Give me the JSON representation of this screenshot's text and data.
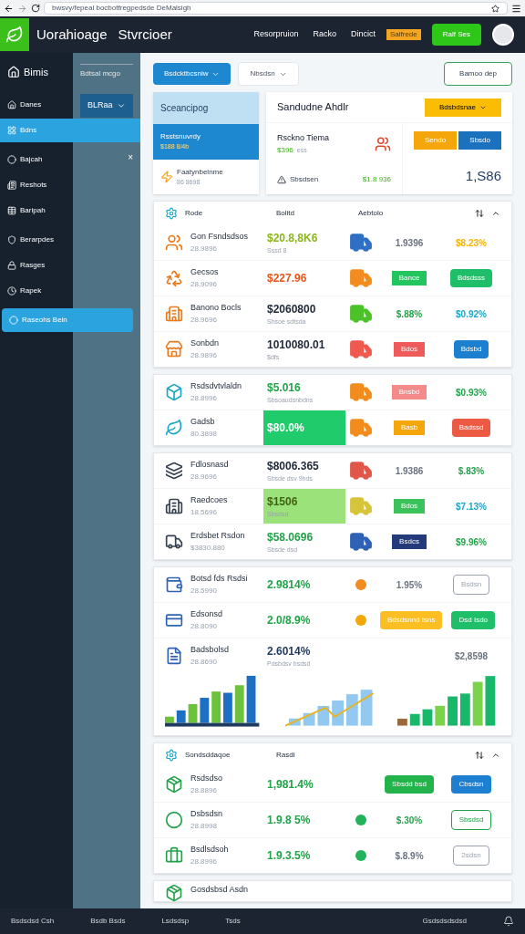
{
  "browser": {
    "url": "bwsvy/fepeal bocbotfregpedsde DeMalsigh"
  },
  "header": {
    "logo_text": "Uorahioage",
    "title": "Stvrcioer",
    "nav": [
      "Resorpruion",
      "Racko",
      "Dincict"
    ],
    "notice": "Salfrede",
    "action": "Ralf Ses"
  },
  "sidebar": {
    "title": "Bimis",
    "items": [
      {
        "label": "Danes",
        "selected": false
      },
      {
        "label": "Bdns",
        "selected": true
      },
      {
        "label": "Bajcah",
        "selected": false
      },
      {
        "label": "Reshots",
        "selected": false
      },
      {
        "label": "Baripah",
        "selected": false
      },
      {
        "label": "Berarpdes",
        "selected": false
      },
      {
        "label": "Rasges",
        "selected": false
      },
      {
        "label": "Rapek",
        "selected": false
      },
      {
        "label": "Raseohs Bein",
        "selected": true
      }
    ]
  },
  "subpanel": {
    "heading": "Bdtsal mcgo",
    "dropdown": "BLRaa",
    "close": "×"
  },
  "toolbar": {
    "primary": "Bsdcktbcsniw",
    "filter": "Nbsdsn",
    "export": "Bamoo dep"
  },
  "summary_left": {
    "title": "Sceancipog",
    "items": [
      {
        "name": "Rsstsnuvrdy",
        "sub": "$188 8/4b",
        "selected": true
      },
      {
        "name": "Faatynbelnme",
        "sub": "86 8698",
        "selected": false
      }
    ]
  },
  "summary_right": {
    "title": "Sandudne Ahdlr",
    "action": "Bdsbdsnae",
    "name": "Rsckno Tiema",
    "name_value": "$396",
    "name_note": "ess",
    "stat_label": "Sbsdsen",
    "stat_value": "$1.8 936",
    "buttons": [
      "Sendo",
      "Sbsdo"
    ],
    "total": "1,S86"
  },
  "sections": [
    {
      "columns": [
        "Rode",
        "Bolitd",
        "Aebtolo"
      ],
      "rows": [
        {
          "name": "Gon Fsndsdsos",
          "sub": "28.9896",
          "value": {
            "text": "$20.8,8K6",
            "color": "#8cb61c",
            "note": "Sssd 8"
          },
          "cells": [
            {
              "kind": "truck",
              "color": "#2f6fc4"
            },
            {
              "kind": "text",
              "text": "1.9396",
              "color": "#6b7280"
            },
            {
              "kind": "text",
              "text": "$8.23%",
              "color": "#f4b400"
            }
          ]
        },
        {
          "name": "Gecsos",
          "sub": "28.9096",
          "value": {
            "text": "$227.96",
            "color": "#e2571c"
          },
          "cells": [
            {
              "kind": "truck",
              "color": "#f28c1e"
            },
            {
              "kind": "badge",
              "text": "Bance",
              "color": "#22c55e"
            },
            {
              "kind": "button",
              "text": "Bdsdsss",
              "color": "#1fbf6a"
            }
          ]
        },
        {
          "name": "Banono Bocls",
          "sub": "28.9696",
          "value": {
            "text": "$2060800",
            "color": "#1f2937",
            "note": "Shsoe sdtsda"
          },
          "cells": [
            {
              "kind": "truck",
              "color": "#4cc22a"
            },
            {
              "kind": "text",
              "text": "$.88%",
              "color": "#22a34a"
            },
            {
              "kind": "text",
              "text": "$0.92%",
              "color": "#1aa6c8"
            }
          ]
        },
        {
          "name": "Sonbdn",
          "sub": "28.9896",
          "value": {
            "text": "1010080.01",
            "color": "#1f2937",
            "note": "$dfs"
          },
          "cells": [
            {
              "kind": "truck",
              "color": "#ef5a4f"
            },
            {
              "kind": "badge",
              "text": "Bdos",
              "color": "#ef5a5a"
            },
            {
              "kind": "button",
              "text": "Bdsbd",
              "color": "#1d7fd0"
            }
          ]
        }
      ]
    },
    {
      "rows": [
        {
          "name": "Rsdsdvtvlaldn",
          "sub": "28.8996",
          "value": {
            "text": "$5.016",
            "color": "#22a34a",
            "note": "Sbsoaudsnbdns"
          },
          "cells": [
            {
              "kind": "truck",
              "color": "#f28c1e"
            },
            {
              "kind": "badge",
              "text": "Bnsbd",
              "color": "#f48b8b"
            },
            {
              "kind": "text",
              "text": "$0.93%",
              "color": "#22a34a"
            }
          ]
        },
        {
          "name": "Gadsb",
          "sub": "80.3898",
          "value": {
            "text": "$80.0%",
            "color": "#ffffff",
            "kind": "highlight"
          },
          "cells": [
            {
              "kind": "truck",
              "color": "#f28c1e"
            },
            {
              "kind": "badge",
              "text": "Basb",
              "color": "#f5a60b"
            },
            {
              "kind": "button",
              "text": "Badssd",
              "color": "#ec5a43"
            }
          ]
        }
      ]
    },
    {
      "rows": [
        {
          "name": "Fdlosnasd",
          "sub": "28.9696",
          "value": {
            "text": "$8006.365",
            "color": "#1f2937",
            "note": "Sbsde dsv 9hds"
          },
          "cells": [
            {
              "kind": "truck",
              "color": "#e0574a"
            },
            {
              "kind": "text",
              "text": "1.9386",
              "color": "#6b7280"
            },
            {
              "kind": "text",
              "text": "$.83%",
              "color": "#22a34a"
            }
          ]
        },
        {
          "name": "Raedcoes",
          "sub": "18.5696",
          "value": {
            "text": "$1506",
            "color": "#3f6212",
            "note": "Sbsdsd",
            "kind": "soft_highlight"
          },
          "cells": [
            {
              "kind": "truck",
              "color": "#d6c43a"
            },
            {
              "kind": "badge",
              "text": "Bdos",
              "color": "#3cc25a"
            },
            {
              "kind": "text",
              "text": "$7.13%",
              "color": "#1aa6c8"
            }
          ]
        },
        {
          "name": "Erdsbet Rsdon",
          "sub": "$3830.880",
          "value": {
            "text": "$58.0696",
            "color": "#22a34a",
            "note": "Sbsde dsd"
          },
          "cells": [
            {
              "kind": "truck",
              "color": "#2f62b5"
            },
            {
              "kind": "badge",
              "text": "Bsdcs",
              "color": "#243a7a"
            },
            {
              "kind": "text",
              "text": "$9.96%",
              "color": "#22a34a"
            }
          ]
        }
      ]
    },
    {
      "rows": [
        {
          "name": "Botsd fds Rsdsi",
          "sub": "28.5990",
          "value": {
            "text": "2.9814%",
            "color": "#22a34a"
          },
          "cells": [
            {
              "kind": "dot",
              "color": "#f28c1e"
            },
            {
              "kind": "text",
              "text": "1.95%",
              "color": "#6b7280"
            },
            {
              "kind": "outline",
              "text": "Bsdsn",
              "color": "#9ca3af"
            }
          ]
        },
        {
          "name": "Edsonsd",
          "sub": "28.8090",
          "value": {
            "text": "2.0/8.9%",
            "color": "#22a34a"
          },
          "cells": [
            {
              "kind": "dot",
              "color": "#f5a60b"
            },
            {
              "kind": "button",
              "text": "Bdsdsnnd Isns",
              "color": "#fbbf24"
            },
            {
              "kind": "button",
              "text": "Dsd Isdo",
              "color": "#1fbf6a"
            }
          ]
        },
        {
          "name": "Badsbolsd",
          "sub": "28.8690",
          "value": {
            "text": "2.6014%",
            "color": "#1e3a5f",
            "note": "Pdsbdsv bsdsd"
          },
          "cells": [
            null,
            null,
            {
              "kind": "text",
              "text": "$2,8598",
              "color": "#6b7280"
            }
          ],
          "charts": true
        }
      ]
    },
    {
      "columns": [
        "Sondsddaqoe",
        "Rasdi"
      ],
      "rows": [
        {
          "name": "Rsdsdso",
          "sub": "28.8896",
          "value": {
            "text": "1,981.4%",
            "color": "#22a34a"
          },
          "cells": [
            null,
            {
              "kind": "button",
              "text": "Sbsdd bsd",
              "color": "#22b34a"
            },
            {
              "kind": "button",
              "text": "Cbsdsn",
              "color": "#1d7fd0"
            }
          ]
        },
        {
          "name": "Dsbsdsn",
          "sub": "28.8998",
          "value": {
            "text": "1.9.8 5%",
            "color": "#22a34a"
          },
          "cells": [
            {
              "kind": "dot",
              "color": "#22b35a"
            },
            {
              "kind": "text",
              "text": "$.30%",
              "color": "#22a34a"
            },
            {
              "kind": "outline",
              "text": "Sbsdsd",
              "color": "#22a34a"
            }
          ]
        },
        {
          "name": "Bsdlsdsoh",
          "sub": "28.8996",
          "value": {
            "text": "1.9.3.5%",
            "color": "#22a34a"
          },
          "cells": [
            {
              "kind": "dot",
              "color": "#22b35a"
            },
            {
              "kind": "text",
              "text": "$.8.9%",
              "color": "#6b7280"
            },
            {
              "kind": "outline",
              "text": "2sdsn",
              "color": "#9ca3af"
            }
          ]
        }
      ]
    },
    {
      "rows": [
        {
          "name": "Gosdsbsd Asdn",
          "cells": []
        }
      ]
    }
  ],
  "footer": {
    "items": [
      "Bsdsdsd Csh",
      "Bsdb Bsds",
      "Lsdsdsp",
      "Tsds",
      "Gsdsdsdsdsd"
    ]
  }
}
